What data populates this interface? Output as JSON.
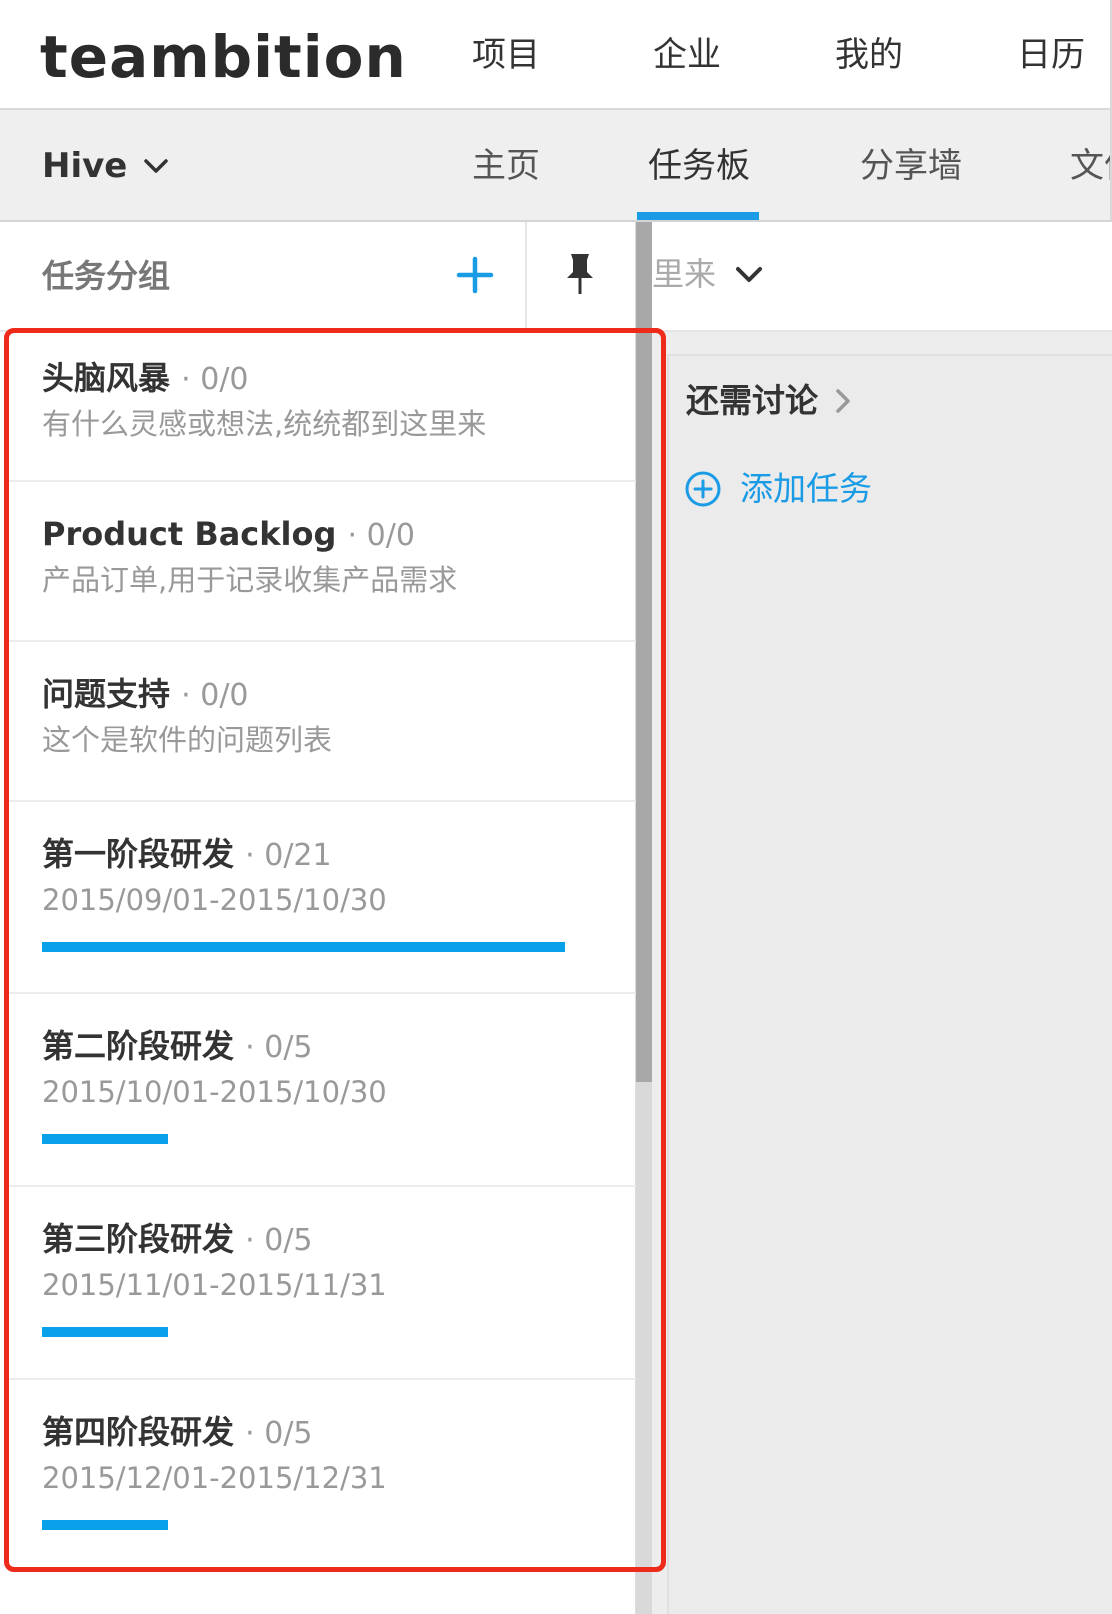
{
  "app": {
    "logo": "teambition"
  },
  "top_nav": [
    "项目",
    "企业",
    "我的",
    "日历"
  ],
  "project": {
    "name": "Hive"
  },
  "sub_nav": {
    "home": "主页",
    "board": "任务板",
    "share": "分享墙",
    "files": "文件"
  },
  "sidebar": {
    "title": "任务分组",
    "groups": [
      {
        "name": "头脑风暴",
        "count": "· 0/0",
        "desc": "有什么灵感或想法,统统都到这里来",
        "progress": 0
      },
      {
        "name": "Product Backlog",
        "count": "· 0/0",
        "desc": "产品订单,用于记录收集产品需求",
        "progress": 0
      },
      {
        "name": "问题支持",
        "count": "· 0/0",
        "desc": "这个是软件的问题列表",
        "progress": 0
      },
      {
        "name": "第一阶段研发",
        "count": "· 0/21",
        "desc": "2015/09/01-2015/10/30",
        "progress": 1.0
      },
      {
        "name": "第二阶段研发",
        "count": "· 0/5",
        "desc": "2015/10/01-2015/10/30",
        "progress": 0.24
      },
      {
        "name": "第三阶段研发",
        "count": "· 0/5",
        "desc": "2015/11/01-2015/11/31",
        "progress": 0.24
      },
      {
        "name": "第四阶段研发",
        "count": "· 0/5",
        "desc": "2015/12/01-2015/12/31",
        "progress": 0.24
      }
    ]
  },
  "board": {
    "group_selector": "里来",
    "stage_title": "还需讨论",
    "add_task": "添加任务"
  },
  "colors": {
    "accent": "#1a9be6",
    "highlight": "#ee2a1b"
  }
}
